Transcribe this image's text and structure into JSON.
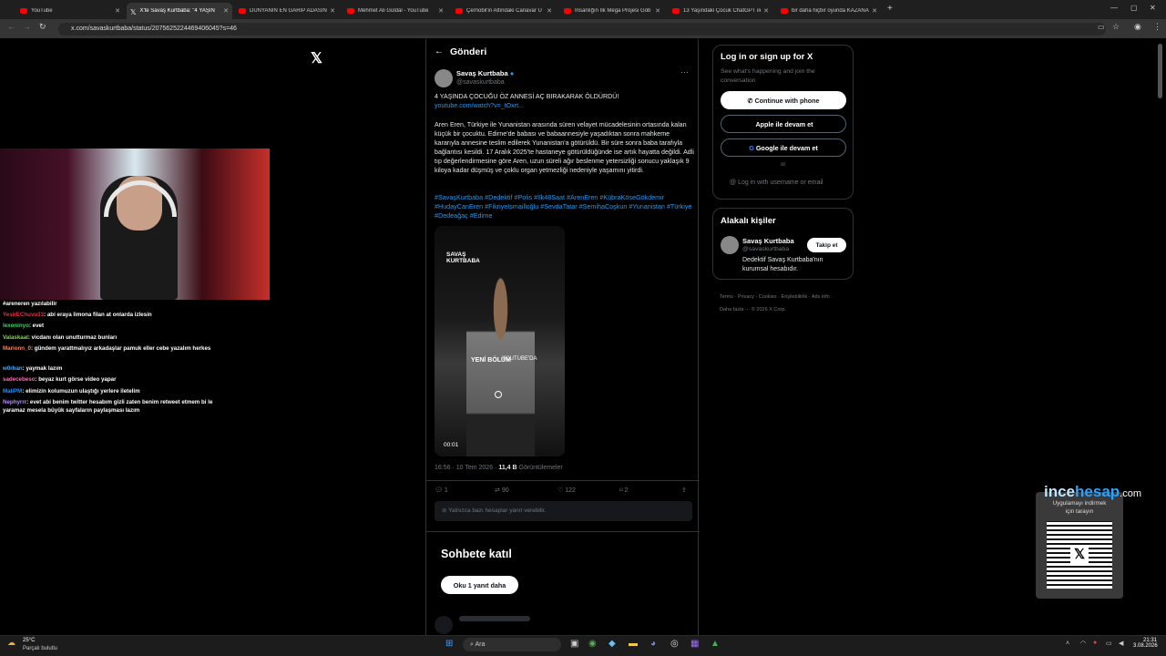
{
  "browser": {
    "tabs": [
      {
        "title": "YouTube"
      },
      {
        "title": "X'te Savaş Kurtbaba: \"4 YAŞIN"
      },
      {
        "title": "DÜNYANIN EN GARİP ADASIN"
      },
      {
        "title": "Mehmet Ali Güldal - YouTube"
      },
      {
        "title": "Çernobil'in Altındaki Canavar U"
      },
      {
        "title": "İnsanlığın İlk Mega Projesi Göb"
      },
      {
        "title": "13 Yaşındaki Çocuk ChatGPT ile"
      },
      {
        "title": "bir daha hiçbir oyunda KAZANA"
      }
    ],
    "new_tab": "+",
    "url": "x.com/savaskurtbaba/status/2075625224469406045?s=46"
  },
  "stream": {
    "chat": [
      {
        "user": "",
        "text": "#areneren yazılabilir"
      },
      {
        "user": "YesirEChuvo33",
        "text": "abi eraya limona filan at onlarda izlesin"
      },
      {
        "user": "lexoninyo",
        "text": "evet"
      },
      {
        "user": "Valaskaal",
        "text": "vicdanı olan unutturmaz bunları"
      },
      {
        "user": "Marionn_0",
        "text": "gündem yarattmalıyız arkadaşlar pamuk eller cebe yazalım herkes"
      },
      {
        "user": "w0rhan",
        "text": "yaymak lazım"
      },
      {
        "user": "sadecebeso",
        "text": "beyaz kurt görse video yapar"
      },
      {
        "user": "MaliPM",
        "text": "elimizin kolumuzun ulaştığı yerlere iletelim"
      },
      {
        "user": "Nephyrrr",
        "text": "evet abi benim twitter hesabım gizli zaten benim retweet etmem bi le yaramaz mesela büyük sayfaların paylaşması lazım"
      }
    ]
  },
  "post": {
    "header": "Gönderi",
    "author": {
      "name": "Savaş Kurtbaba",
      "handle": "@savaskurtbaba"
    },
    "more": "···",
    "headline": "4 YAŞINDA ÇOCUĞU ÖZ ANNESİ AÇ BIRAKARAK ÖLDÜRDÜ!",
    "link": "youtube.com/watch?v=_tOxrt...",
    "body": "Aren Eren, Türkiye ile Yunanistan arasında süren velayet mücadelesinin ortasında kalan küçük bir çocuktu. Edirne'de babası ve babaannesiyle yaşadıktan sonra mahkeme kararıyla annesine teslim edilerek Yunanistan'a götürüldü. Bir süre sonra baba tarafıyla bağlantısı kesildi. 17 Aralık 2025'te hastaneye götürüldüğünde ise artık hayatta değildi. Adli tıp değerlendirmesine göre Aren, uzun süreli ağır beslenme yetersizliği sonucu yaklaşık 9 kiloya kadar düşmüş ve çoklu organ yetmezliği nedeniyle yaşamını yitirdi.",
    "hashtags": "#SavaşKurtbaba #Dedektif #Polis #İlk48Saat #ArenEren #KübraKöseGökdemir #HudayCanEren #FikriyeIsmailloğlu #SevdaTatar #SemihaCoşkun #Yunanistan #Türkiye #Dedeağaç #Edirne",
    "video": {
      "brand": "SAVAŞ KURTBABA",
      "caption": "YENİ BÖLÜM",
      "caption2": "YOUTUBE'DA",
      "time": "00:01"
    },
    "meta_time": "16:56 · 10 Tem 2026 · ",
    "views_count": "11,4 B",
    "views_label": " Görüntülemeler",
    "stats": {
      "replies": "1",
      "reposts": "90",
      "likes": "122",
      "bookmarks": "2"
    },
    "reply_notice": "Yalnızca bazı hesaplar yanıt verebilir.",
    "join_title": "Sohbete katıl",
    "read_more": "Oku 1 yanıt daha"
  },
  "sidebar": {
    "login_title": "Log in or sign up for X",
    "login_sub": "See what's happening and join the conversation",
    "btn_phone": "Continue with phone",
    "btn_apple": "Apple ile devam et",
    "btn_google": "Google ile devam et",
    "or": "or",
    "btn_username": "Log in with username or email",
    "related_title": "Alakalı kişiler",
    "related": {
      "name": "Savaş Kurtbaba",
      "handle": "@savaskurtbaba",
      "follow": "Takip et",
      "bio": "Dedektif Savaş Kurtbaba'nın kurumsal hesabıdır."
    },
    "footer1": "Terms · Privacy · Cookies · Erişilebilirlik · Ads info ·",
    "footer2": "Daha fazla ··· © 2026 X Corp."
  },
  "watermark": {
    "brand_a": "ince",
    "brand_b": "hesap",
    "brand_c": ".com",
    "qr_text1": "Uygulamayı indirmek",
    "qr_text2": "için tarayın"
  },
  "taskbar": {
    "weather_temp": "25°C",
    "weather_desc": "Parçalı bulutlu",
    "search": "Ara",
    "time": "21:31",
    "date": "3.08.2026"
  }
}
